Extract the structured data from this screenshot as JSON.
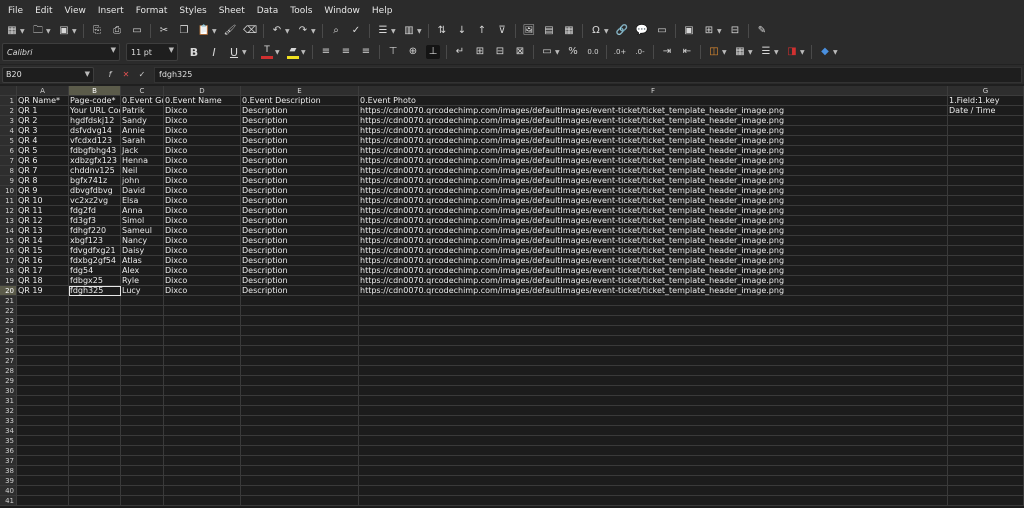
{
  "menu": [
    "File",
    "Edit",
    "View",
    "Insert",
    "Format",
    "Styles",
    "Sheet",
    "Data",
    "Tools",
    "Window",
    "Help"
  ],
  "toolbar": {
    "font_name": "Calibri",
    "font_size": "11 pt",
    "bold": "B",
    "italic": "I",
    "underline": "U",
    "percent": "%",
    "decimal": "0.0"
  },
  "formula_bar": {
    "cell_ref": "B20",
    "fx": "f",
    "sum": "Σ",
    "cancel": "✕",
    "accept": "✓",
    "content": "fdgh325"
  },
  "columns": [
    "A",
    "B",
    "C",
    "D",
    "E",
    "F",
    "G"
  ],
  "selected_column": "B",
  "selected_row": 20,
  "headers": [
    "QR Name*",
    "Page-code*",
    "0.Event Guest",
    "0.Event Name",
    "0.Event Description",
    "0.Event Photo",
    "1.Field:1.key"
  ],
  "rows": [
    [
      "QR 1",
      "Your URL Code",
      "Patrik",
      "Dixco",
      "Description",
      "https://cdn0070.qrcodechimp.com/images/defaultImages/event-ticket/ticket_template_header_image.png",
      "Date / Time"
    ],
    [
      "QR 2",
      "hgdfdskj12",
      "Sandy",
      "Dixco",
      "Description",
      "https://cdn0070.qrcodechimp.com/images/defaultImages/event-ticket/ticket_template_header_image.png",
      ""
    ],
    [
      "QR 3",
      "dsfvdvg14",
      "Annie",
      "Dixco",
      "Description",
      "https://cdn0070.qrcodechimp.com/images/defaultImages/event-ticket/ticket_template_header_image.png",
      ""
    ],
    [
      "QR 4",
      "vfcdxd123",
      "Sarah",
      "Dixco",
      "Description",
      "https://cdn0070.qrcodechimp.com/images/defaultImages/event-ticket/ticket_template_header_image.png",
      ""
    ],
    [
      "QR 5",
      "fdbgfbhg43",
      "Jack",
      "Dixco",
      "Description",
      "https://cdn0070.qrcodechimp.com/images/defaultImages/event-ticket/ticket_template_header_image.png",
      ""
    ],
    [
      "QR 6",
      "xdbzgfx123",
      "Henna",
      "Dixco",
      "Description",
      "https://cdn0070.qrcodechimp.com/images/defaultImages/event-ticket/ticket_template_header_image.png",
      ""
    ],
    [
      "QR 7",
      "chddnv125",
      "Neil",
      "Dixco",
      "Description",
      "https://cdn0070.qrcodechimp.com/images/defaultImages/event-ticket/ticket_template_header_image.png",
      ""
    ],
    [
      "QR 8",
      "bgfx741z",
      "john",
      "Dixco",
      "Description",
      "https://cdn0070.qrcodechimp.com/images/defaultImages/event-ticket/ticket_template_header_image.png",
      ""
    ],
    [
      "QR 9",
      "dbvgfdbvg",
      "David",
      "Dixco",
      "Description",
      "https://cdn0070.qrcodechimp.com/images/defaultImages/event-ticket/ticket_template_header_image.png",
      ""
    ],
    [
      "QR 10",
      "vc2xz2vg",
      "Elsa",
      "Dixco",
      "Description",
      "https://cdn0070.qrcodechimp.com/images/defaultImages/event-ticket/ticket_template_header_image.png",
      ""
    ],
    [
      "QR 11",
      "fdg2fd",
      "Anna",
      "Dixco",
      "Description",
      "https://cdn0070.qrcodechimp.com/images/defaultImages/event-ticket/ticket_template_header_image.png",
      ""
    ],
    [
      "QR 12",
      "fd3gf3",
      "Simol",
      "Dixco",
      "Description",
      "https://cdn0070.qrcodechimp.com/images/defaultImages/event-ticket/ticket_template_header_image.png",
      ""
    ],
    [
      "QR 13",
      "fdhgf220",
      "Sameul",
      "Dixco",
      "Description",
      "https://cdn0070.qrcodechimp.com/images/defaultImages/event-ticket/ticket_template_header_image.png",
      ""
    ],
    [
      "QR 14",
      "xbgf123",
      "Nancy",
      "Dixco",
      "Description",
      "https://cdn0070.qrcodechimp.com/images/defaultImages/event-ticket/ticket_template_header_image.png",
      ""
    ],
    [
      "QR 15",
      "fdvgdfxg21",
      "Daisy",
      "Dixco",
      "Description",
      "https://cdn0070.qrcodechimp.com/images/defaultImages/event-ticket/ticket_template_header_image.png",
      ""
    ],
    [
      "QR 16",
      "fdxbg2gf54",
      "Atlas",
      "Dixco",
      "Description",
      "https://cdn0070.qrcodechimp.com/images/defaultImages/event-ticket/ticket_template_header_image.png",
      ""
    ],
    [
      "QR 17",
      "fdg54",
      "Alex",
      "Dixco",
      "Description",
      "https://cdn0070.qrcodechimp.com/images/defaultImages/event-ticket/ticket_template_header_image.png",
      ""
    ],
    [
      "QR 18",
      "fdbgx25",
      "Ryle",
      "Dixco",
      "Description",
      "https://cdn0070.qrcodechimp.com/images/defaultImages/event-ticket/ticket_template_header_image.png",
      ""
    ],
    [
      "QR 19",
      "fdgh325",
      "Lucy",
      "Dixco",
      "Description",
      "https://cdn0070.qrcodechimp.com/images/defaultImages/event-ticket/ticket_template_header_image.png",
      ""
    ]
  ],
  "row_numbers": [
    1,
    2,
    3,
    4,
    5,
    6,
    7,
    8,
    9,
    10,
    11,
    12,
    13,
    14,
    15,
    16,
    17,
    18,
    19,
    20,
    21,
    22,
    23,
    24,
    25,
    26,
    27,
    28,
    29,
    30,
    31,
    32,
    33,
    34,
    35,
    36,
    37,
    38,
    39,
    40,
    41
  ],
  "colors": {
    "background": "#1c1c1c",
    "header_bg": "#2e2e2e",
    "selected_header": "#5b5b4a",
    "font_color_bar": "#d03030",
    "highlight_bar": "#f0e020",
    "cancel": "#e05050"
  }
}
